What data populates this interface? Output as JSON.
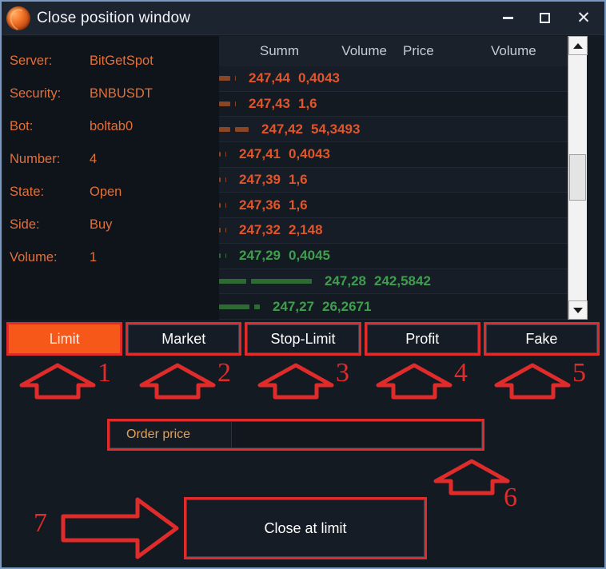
{
  "window": {
    "title": "Close position window",
    "icon": "app-sphere-icon",
    "controls": {
      "minimize": "minimize-icon",
      "maximize": "maximize-icon",
      "close": "close-icon"
    }
  },
  "info_panel": {
    "rows": [
      {
        "label": "Server:",
        "value": "BitGetSpot"
      },
      {
        "label": "Security:",
        "value": "BNBUSDT"
      },
      {
        "label": "Bot:",
        "value": "boltab0"
      },
      {
        "label": "Number:",
        "value": "4"
      },
      {
        "label": "State:",
        "value": "Open"
      },
      {
        "label": "Side:",
        "value": "Buy"
      },
      {
        "label": "Volume:",
        "value": "1"
      }
    ]
  },
  "order_book": {
    "columns": [
      "Summ",
      "Volume",
      "Price",
      "Volume"
    ],
    "rows": [
      {
        "price": "247,44",
        "volume": "0,4043",
        "side": "ask",
        "summ_bar": 14,
        "vol_bar": 1
      },
      {
        "price": "247,43",
        "volume": "1,6",
        "side": "ask",
        "summ_bar": 14,
        "vol_bar": 1
      },
      {
        "price": "247,42",
        "volume": "54,3493",
        "side": "ask",
        "summ_bar": 14,
        "vol_bar": 17
      },
      {
        "price": "247,41",
        "volume": "0,4043",
        "side": "ask",
        "summ_bar": 2,
        "vol_bar": 1
      },
      {
        "price": "247,39",
        "volume": "1,6",
        "side": "ask",
        "summ_bar": 2,
        "vol_bar": 1
      },
      {
        "price": "247,36",
        "volume": "1,6",
        "side": "ask",
        "summ_bar": 2,
        "vol_bar": 1
      },
      {
        "price": "247,32",
        "volume": "2,148",
        "side": "ask",
        "summ_bar": 2,
        "vol_bar": 1
      },
      {
        "price": "247,29",
        "volume": "0,4045",
        "side": "bid",
        "summ_bar": 2,
        "vol_bar": 1
      },
      {
        "price": "247,28",
        "volume": "242,5842",
        "side": "bid",
        "summ_bar": 34,
        "vol_bar": 76
      },
      {
        "price": "247,27",
        "volume": "26,2671",
        "side": "bid",
        "summ_bar": 38,
        "vol_bar": 7
      }
    ],
    "scrollbar": {
      "up_arrow": "scroll-up-icon",
      "down_arrow": "scroll-down-icon"
    }
  },
  "tabs": [
    {
      "label": "Limit",
      "active": true
    },
    {
      "label": "Market",
      "active": false
    },
    {
      "label": "Stop-Limit",
      "active": false
    },
    {
      "label": "Profit",
      "active": false
    },
    {
      "label": "Fake",
      "active": false
    }
  ],
  "annotations": {
    "numbers": [
      "1",
      "2",
      "3",
      "4",
      "5",
      "6",
      "7"
    ],
    "color": "#e02b2b"
  },
  "order_price": {
    "label": "Order price",
    "value": "",
    "placeholder": ""
  },
  "actions": {
    "close_at_limit": "Close at limit"
  },
  "colors": {
    "ask": "#e2542a",
    "bid": "#3f9e4d",
    "accent_orange": "#e2703a",
    "active_tab": "#f6581a",
    "annotation_red": "#e02b2b",
    "window_bg": "#141a22",
    "titlebar_bg": "#1c2430"
  }
}
